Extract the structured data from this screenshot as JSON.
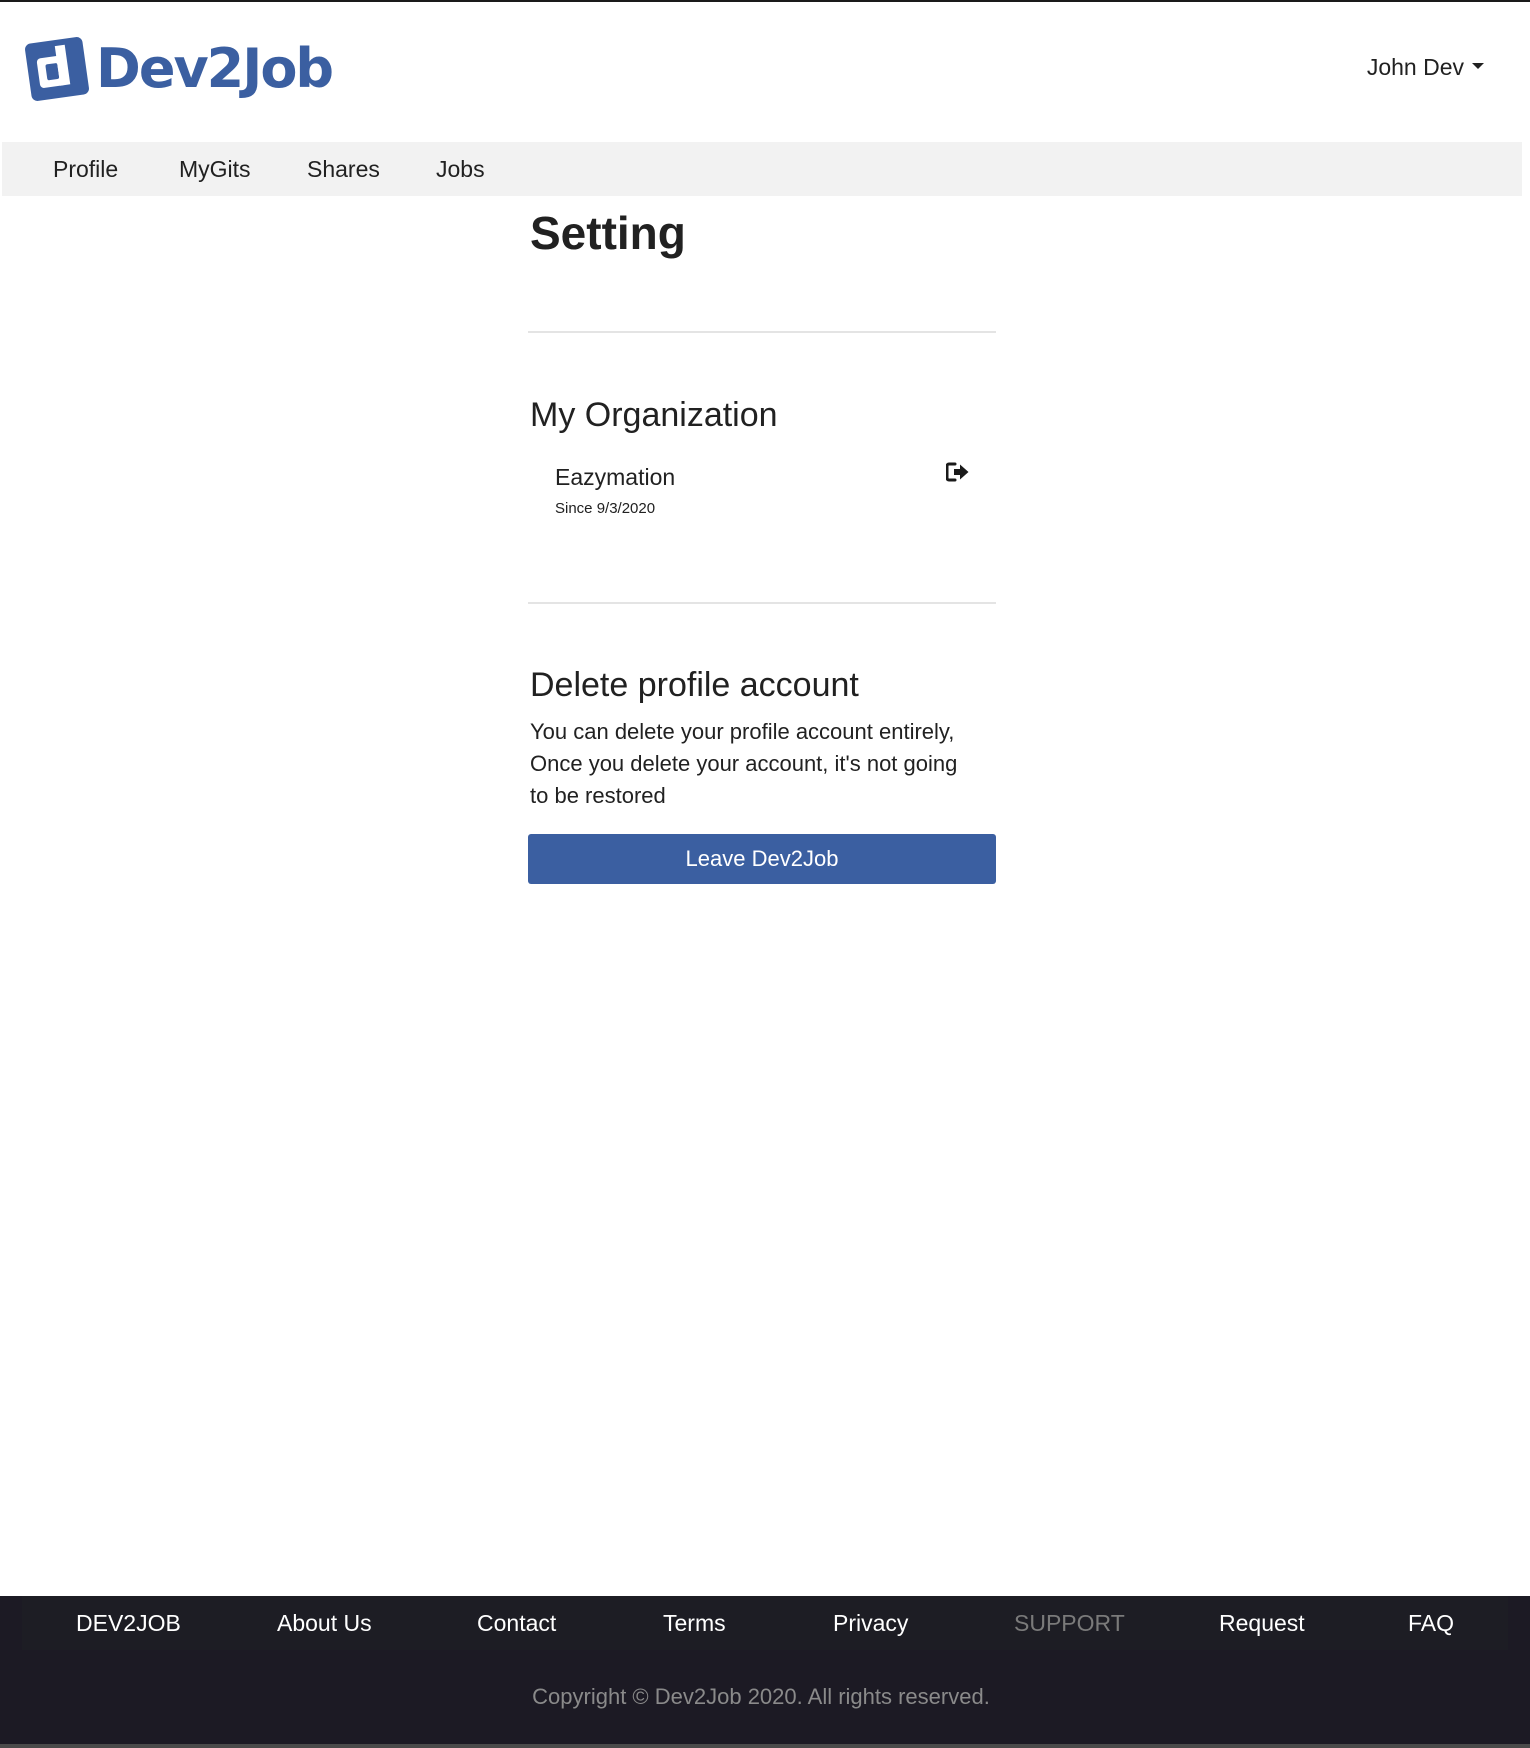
{
  "brand": {
    "logo_text": "Dev2Job",
    "logo_color": "#3b5fa1"
  },
  "user_menu": {
    "name": "John Dev",
    "icon": "caret-down-icon"
  },
  "nav": {
    "items": [
      {
        "label": "Profile"
      },
      {
        "label": "MyGits"
      },
      {
        "label": "Shares"
      },
      {
        "label": "Jobs"
      }
    ]
  },
  "main": {
    "title": "Setting",
    "organization": {
      "heading": "My Organization",
      "name": "Eazymation",
      "since": "Since 9/3/2020",
      "leave_icon": "sign-out-icon"
    },
    "delete_account": {
      "heading": "Delete profile account",
      "description": "You can delete your profile account entirely, Once you delete your account, it's not going to be restored",
      "button_label": "Leave Dev2Job",
      "button_color": "#3b5fa1"
    }
  },
  "footer": {
    "links": [
      {
        "label": "DEV2JOB"
      },
      {
        "label": "About Us"
      },
      {
        "label": "Contact"
      },
      {
        "label": "Terms"
      },
      {
        "label": "Privacy"
      },
      {
        "label": "SUPPORT"
      },
      {
        "label": "Request"
      },
      {
        "label": "FAQ"
      }
    ],
    "copyright": "Copyright © Dev2Job 2020. All rights reserved.",
    "background_color": "#1c1a24"
  }
}
